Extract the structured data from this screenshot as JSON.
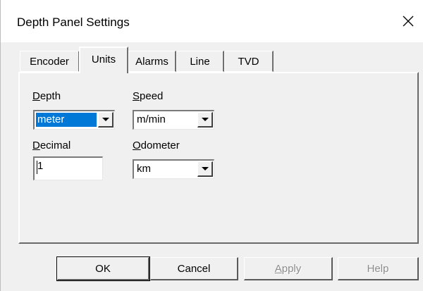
{
  "window": {
    "title": "Depth Panel Settings",
    "close_icon": "close-icon"
  },
  "tabs": [
    {
      "label": "Encoder",
      "active": false
    },
    {
      "label": "Units",
      "active": true
    },
    {
      "label": "Alarms",
      "active": false
    },
    {
      "label": "Line",
      "active": false
    },
    {
      "label": "TVD",
      "active": false
    }
  ],
  "units": {
    "depth": {
      "label_mnemonic": "D",
      "label_rest": "epth",
      "value": "meter"
    },
    "speed": {
      "label_mnemonic": "S",
      "label_rest": "peed",
      "value": "m/min"
    },
    "decimal": {
      "label_mnemonic": "D",
      "label_rest": "ecimal",
      "value": "1"
    },
    "odometer": {
      "label_mnemonic": "O",
      "label_rest": "dometer",
      "value": "km"
    }
  },
  "buttons": {
    "ok": "OK",
    "cancel": "Cancel",
    "apply_mnemonic": "A",
    "apply_rest": "pply",
    "help": "Help"
  },
  "colors": {
    "selection": "#0078d7",
    "dialog_bg": "#f0f0f0"
  }
}
